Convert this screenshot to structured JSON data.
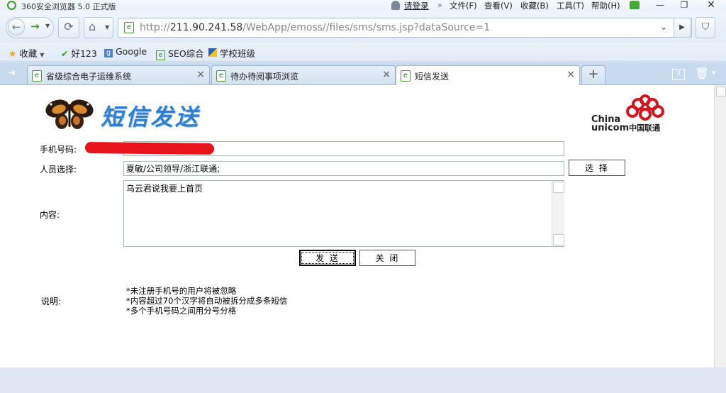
{
  "window": {
    "title": "360安全浏览器 5.0 正式版",
    "login": "请登录",
    "menu": [
      "文件(F)",
      "查看(V)",
      "收藏(B)",
      "工具(T)",
      "帮助(H)"
    ]
  },
  "address": {
    "url_prefix": "http://",
    "url_host": "211.90.241.58",
    "url_path": "/WebApp/emoss//files/sms/sms.jsp?dataSource=1"
  },
  "bookmarks": [
    {
      "label": "收藏"
    },
    {
      "label": "好123"
    },
    {
      "label": "Google"
    },
    {
      "label": "SEO综合"
    },
    {
      "label": "学校班级"
    }
  ],
  "tabs": [
    {
      "label": "省级综合电子运维系统"
    },
    {
      "label": "待办待阅事项浏览"
    },
    {
      "label": "短信发送"
    }
  ],
  "tab_count": "3",
  "page": {
    "heading": "短信发送",
    "logo": {
      "line1": "China",
      "line2": "unicom",
      "cn": "中国联通"
    },
    "form": {
      "phone_label": "手机号码:",
      "phone_value": "",
      "person_label": "人员选择:",
      "person_value": "夏敏/公司领导/浙江联通;",
      "select_button": "选 择",
      "content_label": "内容:",
      "content_value": "乌云君说我要上首页",
      "send_button": "发 送",
      "close_button": "关 闭"
    },
    "notes_label": "说明:",
    "notes": [
      "*未注册手机号的用户将被忽略",
      "*内容超过70个汉字将自动被拆分成多条短信",
      "*多个手机号码之间用分号分格"
    ]
  },
  "colors": {
    "accent": "#2f7fd1",
    "unicom_red": "#d2161f",
    "redact": "#e8141c"
  }
}
